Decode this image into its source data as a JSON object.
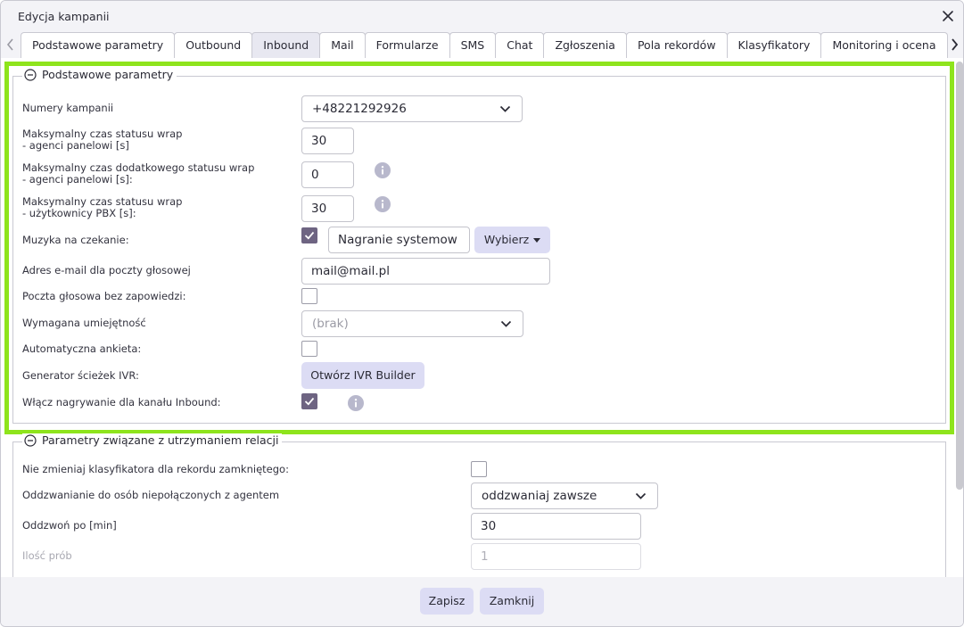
{
  "dialog": {
    "title": "Edycja kampanii"
  },
  "tabs": [
    {
      "label": "Podstawowe parametry"
    },
    {
      "label": "Outbound"
    },
    {
      "label": "Inbound"
    },
    {
      "label": "Mail"
    },
    {
      "label": "Formularze"
    },
    {
      "label": "SMS"
    },
    {
      "label": "Chat"
    },
    {
      "label": "Zgłoszenia"
    },
    {
      "label": "Pola rekordów"
    },
    {
      "label": "Klasyfikatory"
    },
    {
      "label": "Monitoring i ocena"
    }
  ],
  "active_tab": "Inbound",
  "section1": {
    "legend": "Podstawowe parametry",
    "campaign_numbers": {
      "label": "Numery kampanii",
      "value": "+48221292926"
    },
    "max_wrap_panel": {
      "label_line1": "Maksymalny czas statusu wrap",
      "label_line2": "- agenci panelowi [s]",
      "value": "30"
    },
    "max_extra_wrap_panel": {
      "label_line1": "Maksymalny czas dodatkowego statusu wrap",
      "label_line2": "- agenci panelowi [s]:",
      "value": "0"
    },
    "max_wrap_pbx": {
      "label_line1": "Maksymalny czas statusu wrap",
      "label_line2": "- użytkownicy PBX [s]:",
      "value": "30"
    },
    "hold_music": {
      "label": "Muzyka na czekanie:",
      "checked": true,
      "file": "Nagranie systemow",
      "choose_label": "Wybierz"
    },
    "voicemail_email": {
      "label": "Adres e-mail dla poczty głosowej",
      "value": "mail@mail.pl"
    },
    "voicemail_no_announce": {
      "label": "Poczta głosowa bez zapowiedzi:",
      "checked": false
    },
    "required_skill": {
      "label": "Wymagana umiejętność",
      "value": "(brak)"
    },
    "auto_survey": {
      "label": "Automatyczna ankieta:",
      "checked": false
    },
    "ivr_generator": {
      "label": "Generator ścieżek IVR:",
      "button": "Otwórz IVR Builder"
    },
    "inbound_recording": {
      "label": "Włącz nagrywanie dla kanału Inbound:",
      "checked": true
    }
  },
  "section2": {
    "legend": "Parametry związane z utrzymaniem relacji",
    "keep_classifier": {
      "label": "Nie zmieniaj klasyfikatora dla rekordu zamkniętego:",
      "checked": false
    },
    "callback_mode": {
      "label": "Oddzwanianie do osób niepołączonych z agentem",
      "value": "oddzwaniaj zawsze"
    },
    "callback_after": {
      "label": "Oddzwoń po [min]",
      "value": "30"
    },
    "attempts": {
      "label": "Ilość prób",
      "value": "1"
    }
  },
  "footer": {
    "save_label": "Zapisz",
    "close_label": "Zamknij"
  },
  "colors": {
    "highlight": "#8ee41c",
    "checkbox_checked": "#6e6482",
    "button_bg": "#dcdcf4",
    "active_tab_bg": "#e8e8f1"
  }
}
